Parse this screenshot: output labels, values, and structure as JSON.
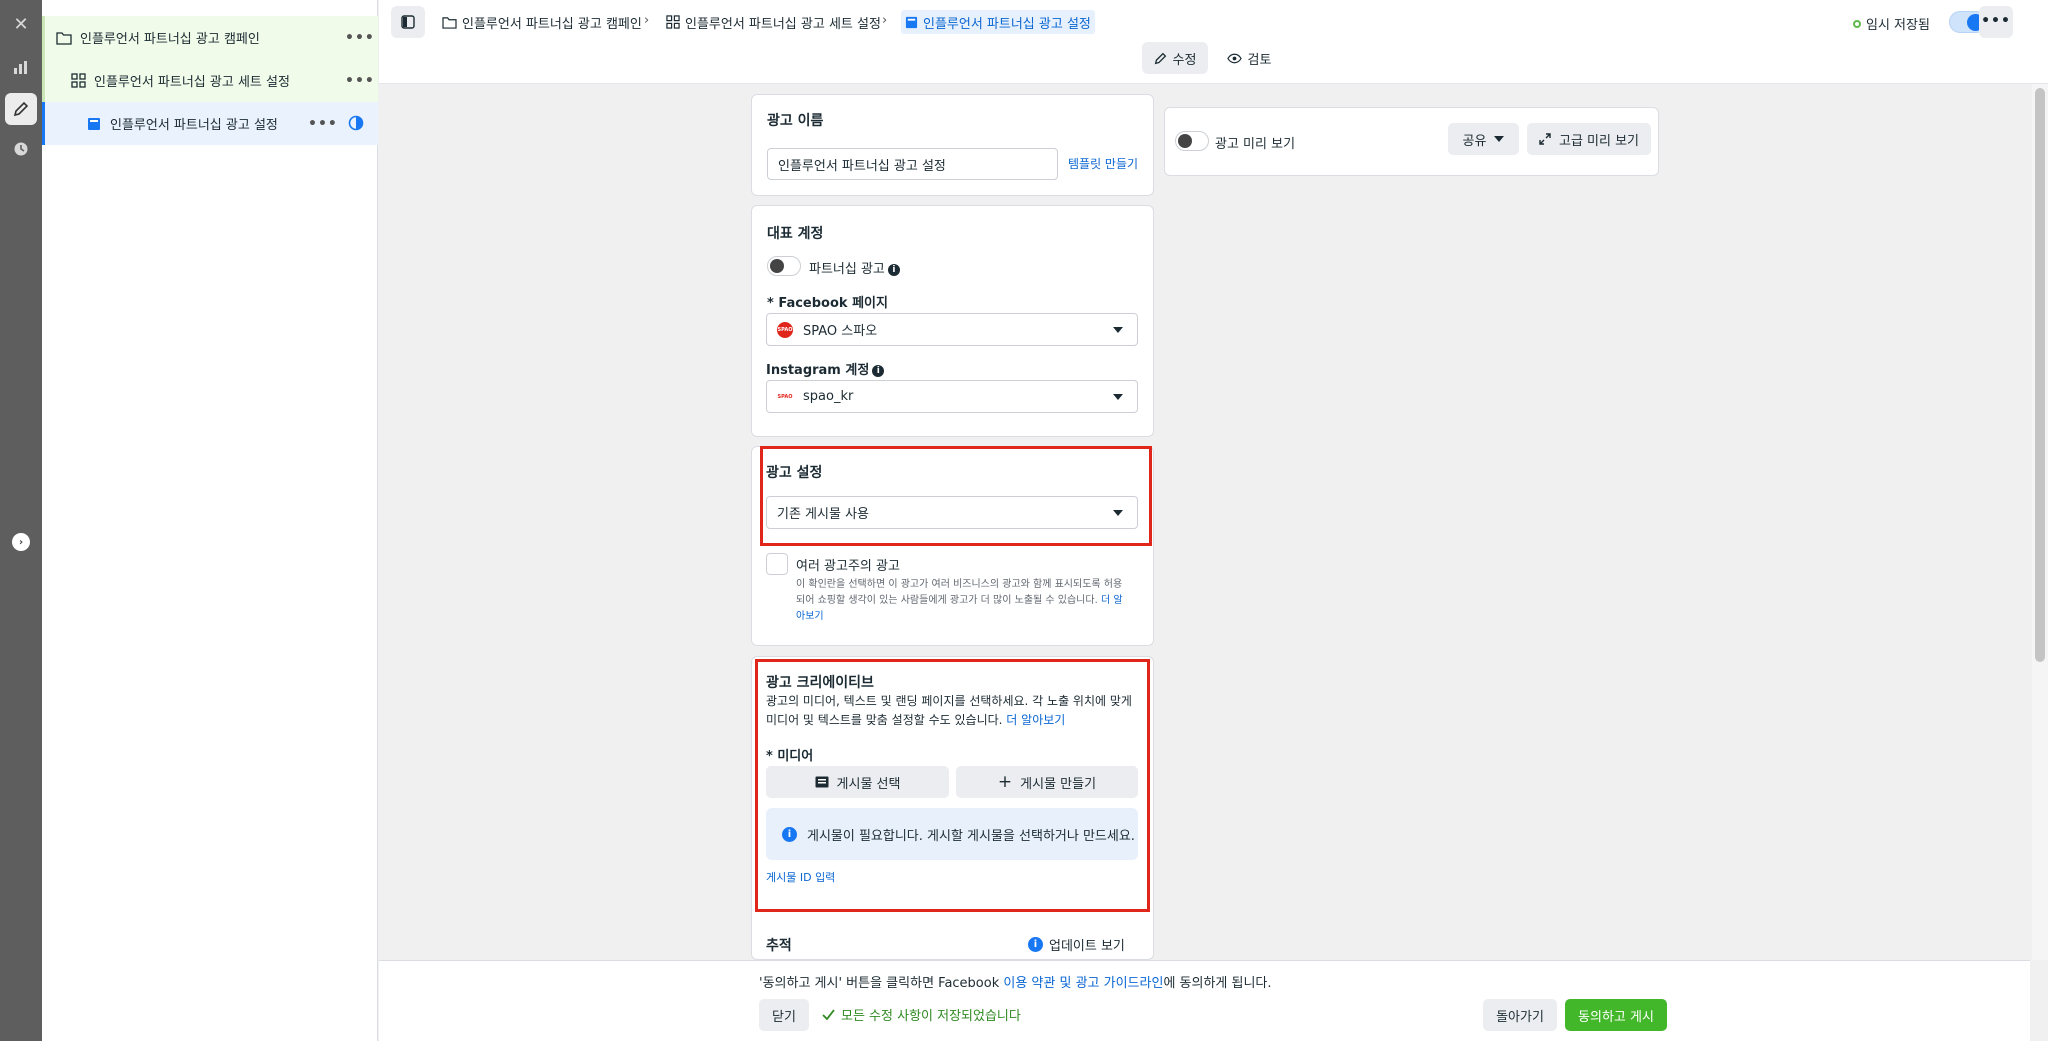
{
  "rail": {
    "close": "✕",
    "items": [
      "chart-icon",
      "pencil-icon",
      "clock-icon"
    ],
    "collapse": "›"
  },
  "tree": {
    "campaign": "인플루언서 파트너십 광고 캠페인",
    "adset": "인플루언서 파트너십 광고 세트 설정",
    "ad": "인플루언서 파트너십 광고 설정",
    "more": "•••"
  },
  "breadcrumb": {
    "campaign": "인플루언서 파트너십 광고 캠페인",
    "adset": "인플루언서 파트너십 광고 세트 설정",
    "ad": "인플루언서 파트너십 광고 설정"
  },
  "modes": {
    "edit": "수정",
    "review": "검토"
  },
  "draft_status": "임시 저장됨",
  "ad_name": {
    "title": "광고 이름",
    "value": "인플루언서  파트너십 광고 설정",
    "template_link": "템플릿 만들기"
  },
  "identity": {
    "title": "대표 계정",
    "partnership_label": "파트너십 광고",
    "fb_page_label": "* Facebook 페이지",
    "fb_page_value": "SPAO 스파오",
    "ig_label": "Instagram 계정",
    "ig_value": "spao_kr",
    "logo_text": "SPAO"
  },
  "ad_setup": {
    "title": "광고 설정",
    "value": "기존 게시물 사용",
    "multi_advertiser_label": "여러 광고주의 광고",
    "multi_advertiser_desc_1": "이 확인란을 선택하면 이 광고가 여러 비즈니스의 광고와 함께 표시되도록 허용",
    "multi_advertiser_desc_2": "되어 쇼핑할 생각이 있는 사람들에게 광고가 더 많이 노출될 수 있습니다.",
    "learn_more_1": "더 알",
    "learn_more_2": "아보기"
  },
  "creative": {
    "title": "광고 크리에이티브",
    "desc_1": "광고의 미디어, 텍스트 및 랜딩 페이지를 선택하세요. 각 노출 위치에 맞게",
    "desc_2": "미디어 및 텍스트를 맞춤 설정할 수도 있습니다.",
    "learn_more": "더 알아보기",
    "media_label": "* 미디어",
    "select_post": "게시물 선택",
    "create_post": "게시물 만들기",
    "notice": "게시물이 필요합니다. 게시할 게시물을 선택하거나 만드세요.",
    "post_id_link": "게시물 ID 입력"
  },
  "tracking": {
    "title": "추적",
    "update": "업데이트 보기"
  },
  "preview": {
    "label": "광고 미리 보기",
    "share": "공유",
    "advanced": "고급 미리 보기"
  },
  "footer": {
    "terms_prefix": "'동의하고 게시' 버튼을 클릭하면 Facebook ",
    "terms_link": "이용 약관 및 광고 가이드라인",
    "terms_suffix": "에 동의하게 됩니다.",
    "close": "닫기",
    "saved": "모든 수정 사항이 저장되었습니다",
    "back": "돌아가기",
    "publish": "동의하고 게시"
  },
  "colors": {
    "accent": "#1877f2",
    "publish": "#42b72a",
    "highlight": "#e0251b",
    "saved": "#2f8a21"
  }
}
